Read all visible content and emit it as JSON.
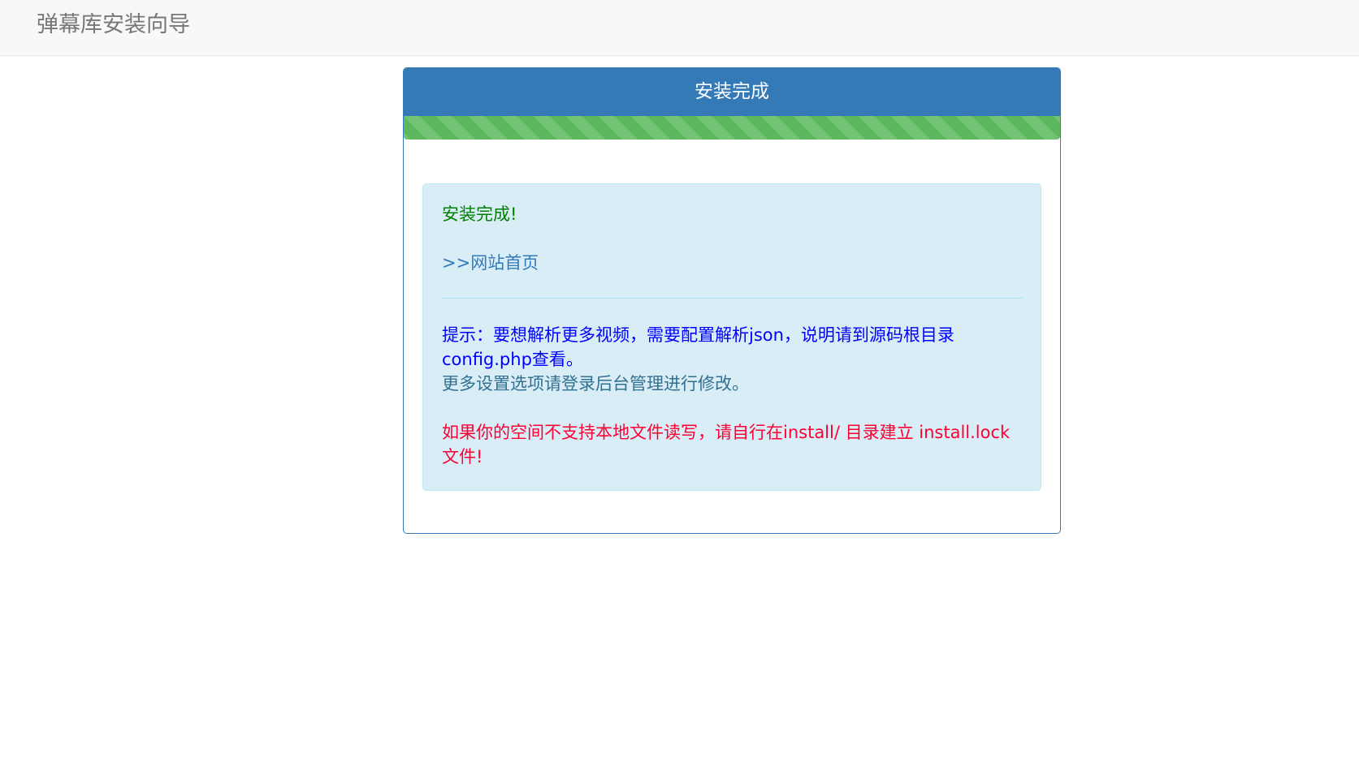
{
  "navbar": {
    "brand": "弹幕库安装向导"
  },
  "panel": {
    "title": "安装完成",
    "progress_percent": 100,
    "progress_color": "#5cb85c"
  },
  "alert": {
    "done": "安装完成!",
    "home_link": ">>网站首页",
    "tip": "提示：要想解析更多视频，需要配置解析json，说明请到源码根目录config.php查看。",
    "settings_note": "更多设置选项请登录后台管理进行修改。",
    "warning": "如果你的空间不支持本地文件读写，请自行在install/ 目录建立 install.lock 文件!"
  },
  "colors": {
    "primary": "#337ab7",
    "success": "#5cb85c",
    "info_bg": "#d9edf7",
    "done_text": "#008000",
    "tip_text": "#0000ff",
    "warning_text": "#ff0033"
  }
}
